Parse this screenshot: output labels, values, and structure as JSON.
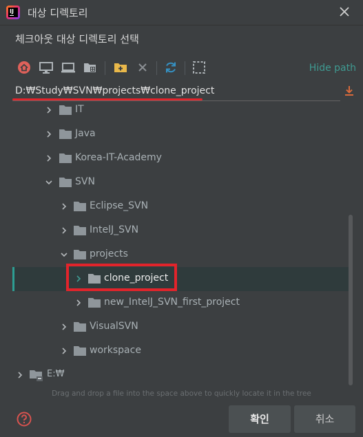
{
  "window": {
    "title": "대상 디렉토리",
    "close_icon": "close-icon"
  },
  "dialog": {
    "subtitle": "체크아웃 대상 디렉토리 선택"
  },
  "toolbar": {
    "buttons": [
      {
        "name": "home-directory-button",
        "icon": "home-icon"
      },
      {
        "name": "desktop-button",
        "icon": "desktop-icon"
      },
      {
        "name": "project-directory-button",
        "icon": "laptop-icon"
      },
      {
        "name": "module-directory-button",
        "icon": "module-folder-icon"
      },
      {
        "name": "new-folder-button",
        "icon": "new-folder-icon"
      },
      {
        "name": "delete-button",
        "icon": "delete-x-icon"
      },
      {
        "name": "refresh-button",
        "icon": "refresh-icon"
      },
      {
        "name": "show-hidden-button",
        "icon": "dashed-square-icon"
      }
    ],
    "hide_path_label": "Hide path"
  },
  "path": {
    "value": "D:₩Study₩SVN₩projects₩clone_project"
  },
  "tree": {
    "items": [
      {
        "label": "IT",
        "expanded": false
      },
      {
        "label": "Java",
        "expanded": false
      },
      {
        "label": "Korea-IT-Academy",
        "expanded": false
      },
      {
        "label": "SVN",
        "expanded": true
      },
      {
        "label": "Eclipse_SVN",
        "expanded": false
      },
      {
        "label": "IntelJ_SVN",
        "expanded": false
      },
      {
        "label": "projects",
        "expanded": true
      },
      {
        "label": "clone_project",
        "expanded": false,
        "selected": true
      },
      {
        "label": "new_IntelJ_SVN_first_project",
        "expanded": false
      },
      {
        "label": "VisualSVN",
        "expanded": false
      },
      {
        "label": "workspace",
        "expanded": false
      },
      {
        "label": "E:₩",
        "expanded": false,
        "drive": true
      }
    ]
  },
  "hint": "Drag and drop a file into the space above to quickly locate it in the tree",
  "buttons": {
    "ok": "확인",
    "cancel": "취소"
  },
  "colors": {
    "accent": "#3f9b92",
    "annotation_red": "#e2242b",
    "background": "#3c3f41",
    "home_icon": "#e0615a",
    "folder_icon": "#e9b84a",
    "refresh_icon": "#3592c4"
  }
}
